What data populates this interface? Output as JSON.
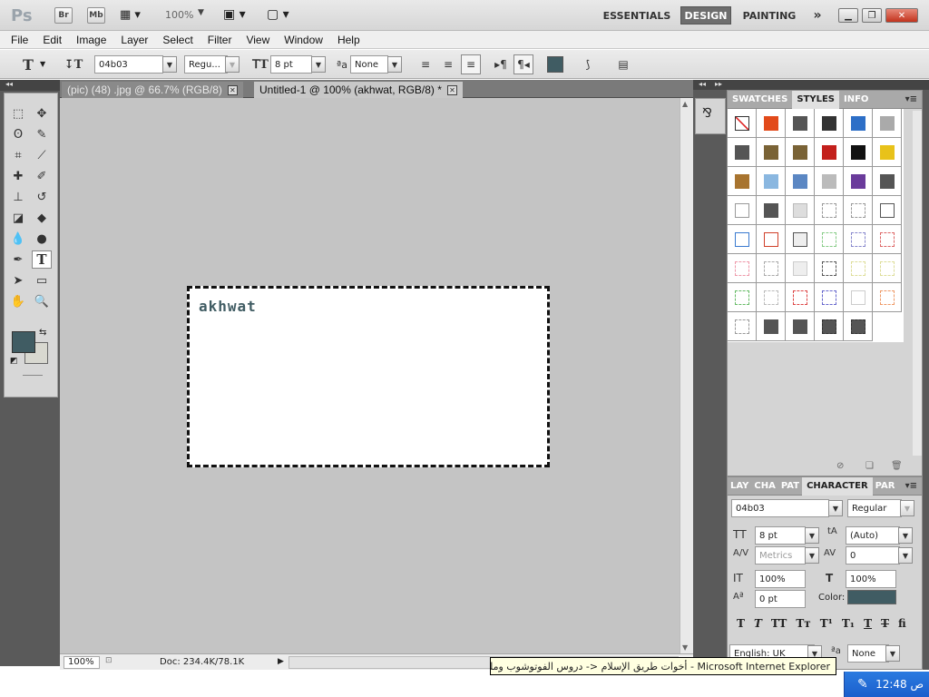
{
  "appbar": {
    "logo": "Ps",
    "bridge_label": "Br",
    "minibridge_label": "Mb",
    "zoom_value": "100%",
    "workspaces": [
      "ESSENTIALS",
      "DESIGN",
      "PAINTING"
    ],
    "more_label": "»"
  },
  "menu": [
    "File",
    "Edit",
    "Image",
    "Layer",
    "Select",
    "Filter",
    "View",
    "Window",
    "Help"
  ],
  "options": {
    "font_family": "04b03",
    "font_style": "Regu...",
    "font_size": "8 pt",
    "antialias": "None",
    "color": "#405c63"
  },
  "tabs": [
    {
      "label": "(pic) (48) .jpg @ 66.7% (RGB/8)"
    },
    {
      "label": "Untitled-1 @ 100% (akhwat, RGB/8) *"
    }
  ],
  "canvas": {
    "text": "akhwat",
    "text_color": "#405c63"
  },
  "status": {
    "zoom": "100%",
    "doc": "Doc: 234.4K/78.1K"
  },
  "styles_panel": {
    "tabs": [
      "SWATCHES",
      "STYLES",
      "INFO"
    ],
    "active": "STYLES"
  },
  "character_panel": {
    "tabs": [
      "LAY",
      "CHA",
      "PAT",
      "CHARACTER",
      "PAR"
    ],
    "font_family": "04b03",
    "font_style": "Regular",
    "font_size": "8 pt",
    "leading": "(Auto)",
    "kerning": "Metrics",
    "tracking": "0",
    "vertical_scale": "100%",
    "horizontal_scale": "100%",
    "baseline_shift": "0 pt",
    "color_label": "Color:",
    "color": "#405c63",
    "language": "English: UK",
    "antialias": "None"
  },
  "taskbar": {
    "tooltip": "أخوات طريق الإسلام <- دروس الفوتوشوب وملحقاته - Microsoft Internet Explorer",
    "clock": "12:48 ص"
  },
  "colors": {
    "foreground": "#405c63",
    "background": "#d8d8d0"
  }
}
